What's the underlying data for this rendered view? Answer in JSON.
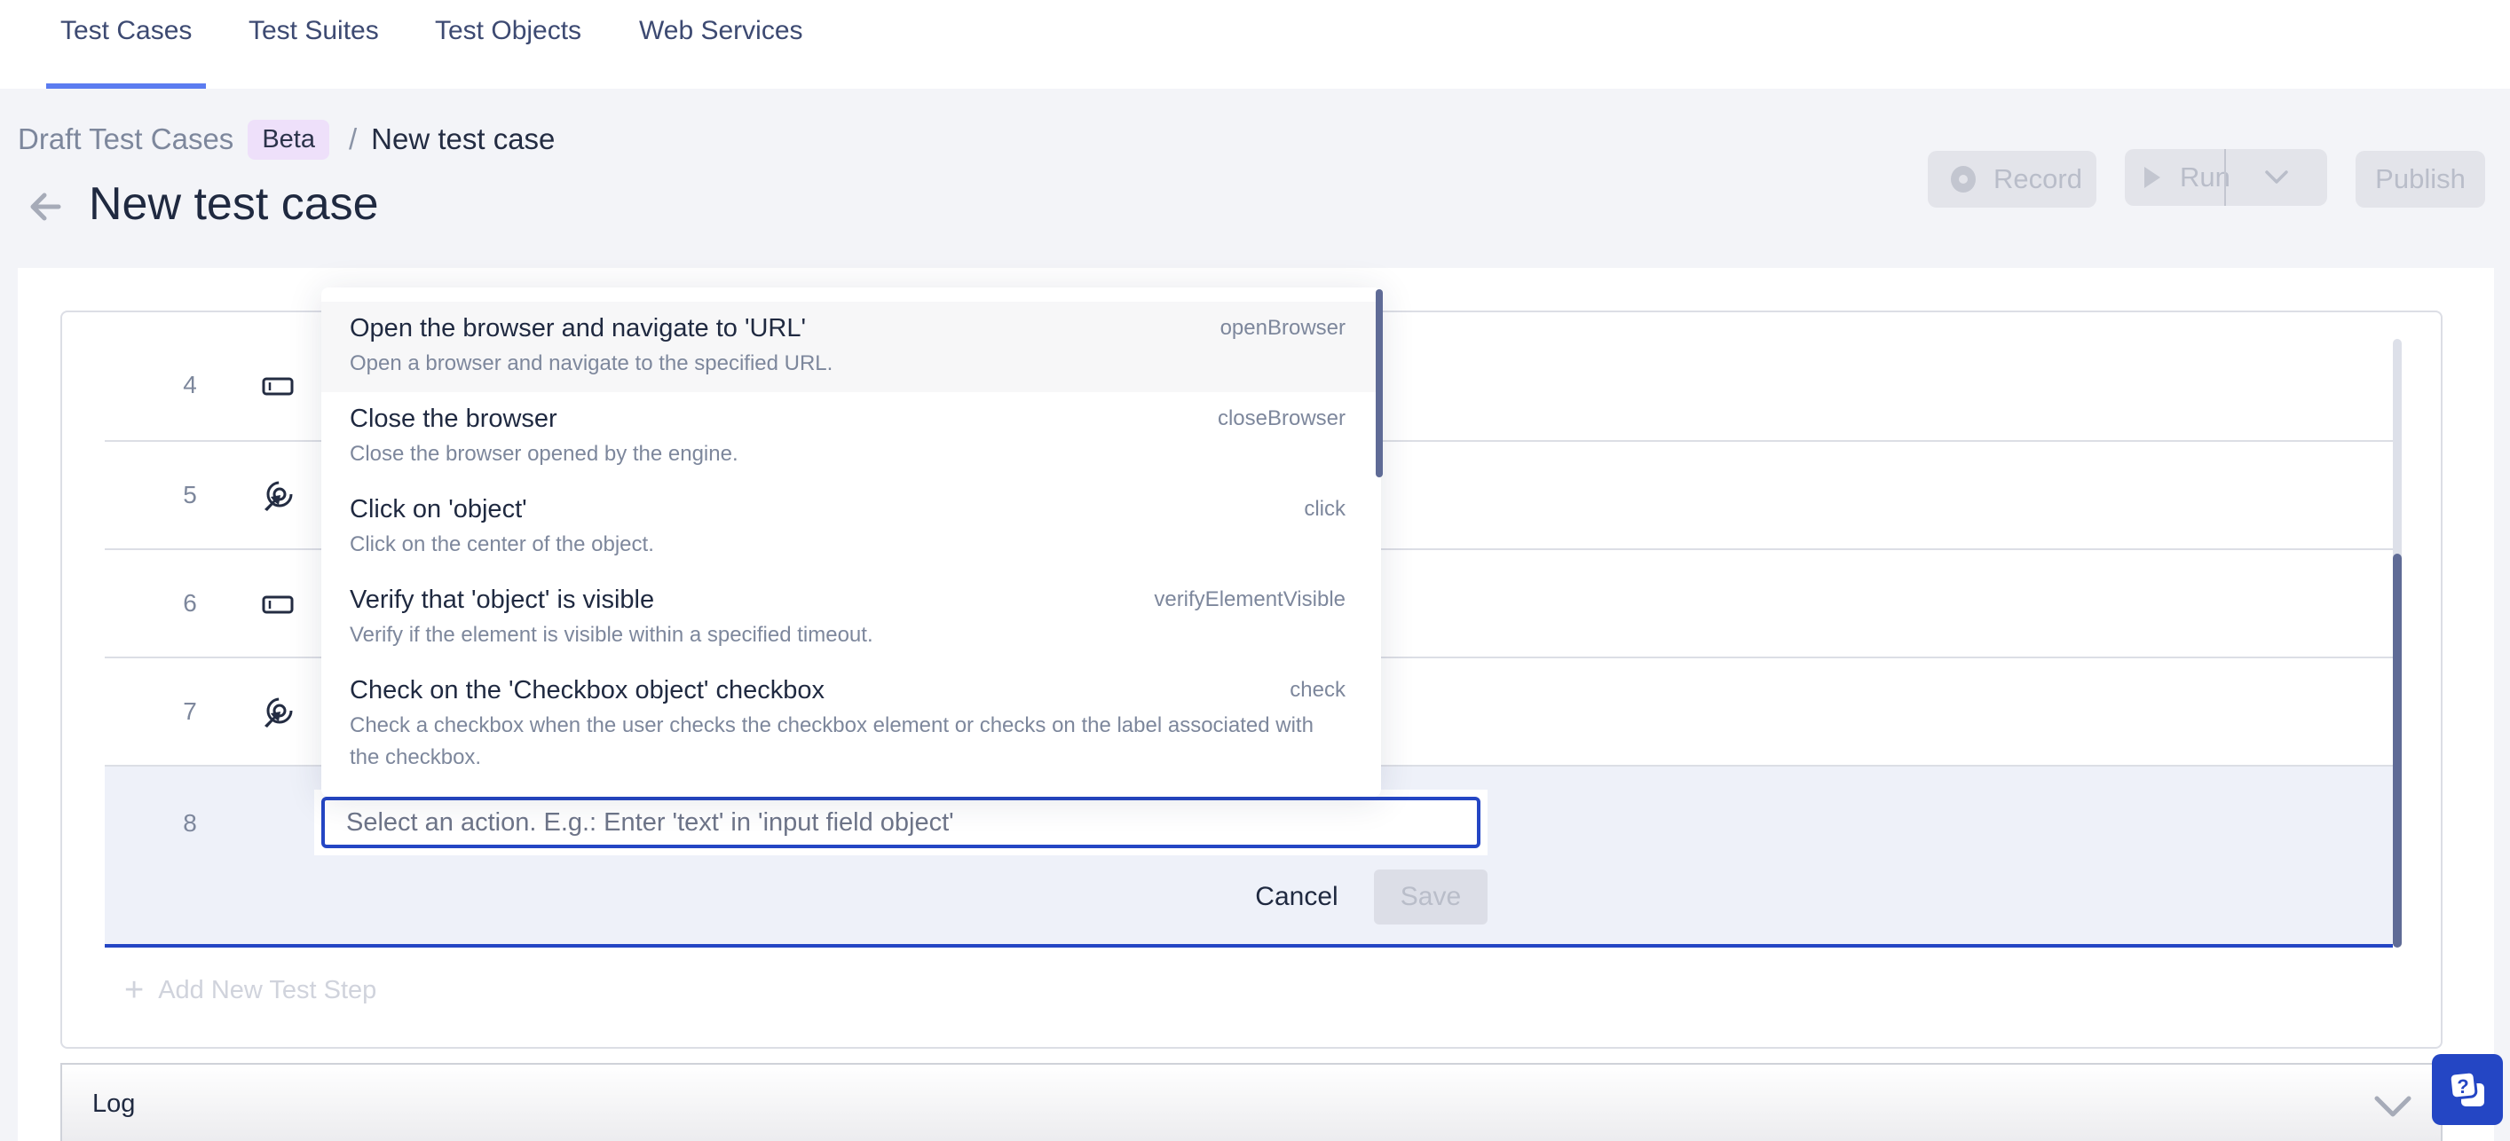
{
  "nav": {
    "tabs": [
      {
        "label": "Test Cases",
        "active": true
      },
      {
        "label": "Test Suites",
        "active": false
      },
      {
        "label": "Test Objects",
        "active": false
      },
      {
        "label": "Web Services",
        "active": false
      }
    ]
  },
  "breadcrumb": {
    "parent": "Draft Test Cases",
    "badge": "Beta",
    "separator": "/",
    "current": "New test case"
  },
  "page": {
    "title": "New test case"
  },
  "toolbar": {
    "record_label": "Record",
    "run_label": "Run",
    "publish_label": "Publish"
  },
  "steps": [
    {
      "number": "4",
      "icon": "input-field-icon"
    },
    {
      "number": "5",
      "icon": "click-target-icon"
    },
    {
      "number": "6",
      "icon": "input-field-icon"
    },
    {
      "number": "7",
      "icon": "click-target-icon"
    },
    {
      "number": "8",
      "icon": ""
    }
  ],
  "action_dropdown": {
    "items": [
      {
        "title": "Open the browser and navigate to 'URL'",
        "description": "Open a browser and navigate to the specified URL.",
        "keyword": "openBrowser",
        "highlighted": true
      },
      {
        "title": "Close the browser",
        "description": "Close the browser opened by the engine.",
        "keyword": "closeBrowser",
        "highlighted": false
      },
      {
        "title": "Click on 'object'",
        "description": "Click on the center of the object.",
        "keyword": "click",
        "highlighted": false
      },
      {
        "title": "Verify that 'object' is visible",
        "description": "Verify if the element is visible within a specified timeout.",
        "keyword": "verifyElementVisible",
        "highlighted": false
      },
      {
        "title": "Check on the 'Checkbox object' checkbox",
        "description": "Check a checkbox when the user checks the checkbox element or checks on the label associated with the checkbox.",
        "keyword": "check",
        "highlighted": false
      }
    ]
  },
  "action_input": {
    "value": "",
    "placeholder": "Select an action. E.g.: Enter 'text' in 'input field object'"
  },
  "editor_buttons": {
    "cancel_label": "Cancel",
    "save_label": "Save"
  },
  "add_step": {
    "label": "Add New Test Step"
  },
  "log": {
    "label": "Log"
  },
  "colors": {
    "accent": "#2446c4",
    "tab_underline": "#5b7cf0",
    "beta_badge_bg": "#eee0fa",
    "active_row_bg": "#eef1f9"
  }
}
